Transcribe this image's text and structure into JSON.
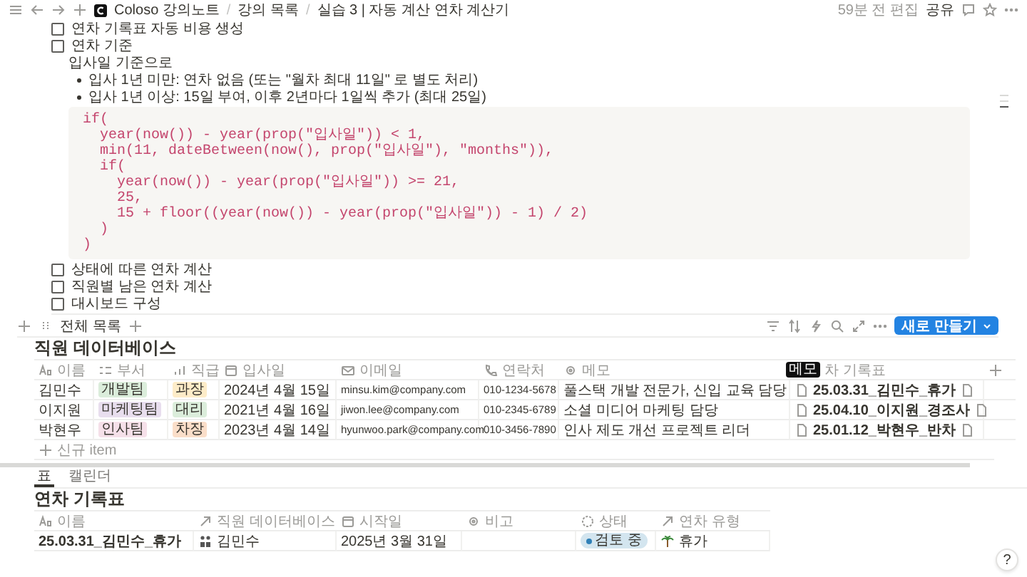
{
  "topbar": {
    "breadcrumbs": [
      "Coloso 강의노트",
      "강의 목록",
      "실습 3 | 자동 계산 연차 계산기"
    ],
    "separator": "/",
    "edited": "59분 전 편집",
    "share": "공유"
  },
  "blocks": [
    {
      "kind": "todo",
      "text": "연차 기록표 자동 비용 생성",
      "checked": false
    },
    {
      "kind": "todo",
      "text": "연차 기준",
      "checked": false
    },
    {
      "kind": "text",
      "text": "입사일 기준으로"
    },
    {
      "kind": "bullet",
      "text": "입사 1년 미만: 연차 없음 (또는 \"월차 최대 11일\" 로 별도 처리)"
    },
    {
      "kind": "bullet",
      "text": "입사 1년 이상: 15일 부여, 이후 2년마다 1일씩 추가 (최대 25일)"
    },
    {
      "kind": "code",
      "lines": [
        "if(",
        "  year(now()) - year(prop(\"입사일\")) < 1,",
        "  min(11, dateBetween(now(), prop(\"입사일\"), \"months\")),",
        "  if(",
        "    year(now()) - year(prop(\"입사일\")) >= 21,",
        "    25,",
        "    15 + floor((year(now()) - year(prop(\"입사일\")) - 1) / 2)",
        "  )",
        ")"
      ]
    },
    {
      "kind": "todo",
      "text": "상태에 따른 연차 계산",
      "checked": false
    },
    {
      "kind": "todo",
      "text": "직원별 남은 연차 계산",
      "checked": false
    },
    {
      "kind": "todo",
      "text": "대시보드 구성",
      "checked": false
    }
  ],
  "employee_db": {
    "view": "전체 목록",
    "new_button": "새로 만들기",
    "title": "직원 데이터베이스",
    "tooltip": "메모",
    "columns": [
      {
        "label": "이름",
        "kind": "title"
      },
      {
        "label": "부서",
        "kind": "multi"
      },
      {
        "label": "직급",
        "kind": "select"
      },
      {
        "label": "입사일",
        "kind": "date"
      },
      {
        "label": "이메일",
        "kind": "email"
      },
      {
        "label": "연락처",
        "kind": "phone"
      },
      {
        "label": "메모",
        "kind": "text"
      },
      {
        "label": "차 기록표"
      }
    ],
    "rows": [
      {
        "name": "김민수",
        "dept": {
          "text": "개발팀",
          "color": "#dbeddb"
        },
        "rank": {
          "text": "과장",
          "color": "#fdecc8"
        },
        "date": "2024년 4월 15일",
        "email": "minsu.kim@company.com",
        "phone": "010-1234-5678",
        "memo": "풀스택 개발 전문가, 신입 교육 담당",
        "record": "25.03.31_김민수_휴가"
      },
      {
        "name": "이지원",
        "dept": {
          "text": "마케팅팀",
          "color": "#e8deee"
        },
        "rank": {
          "text": "대리",
          "color": "#dbeddb"
        },
        "date": "2021년 4월 16일",
        "email": "jiwon.lee@company.com",
        "phone": "010-2345-6789",
        "memo": "소셜 미디어 마케팅 담당",
        "record": "25.04.10_이지원_경조사"
      },
      {
        "name": "박현우",
        "dept": {
          "text": "인사팀",
          "color": "#f5e0e9"
        },
        "rank": {
          "text": "차장",
          "color": "#fadec9"
        },
        "date": "2023년 4월 14일",
        "email": "hyunwoo.park@company.com",
        "phone": "010-3456-7890",
        "memo": "인사 제도 개선 프로젝트 리더",
        "record": "25.01.12_박현우_반차"
      }
    ],
    "new_item": "신규 item"
  },
  "leave_db": {
    "tabs": [
      {
        "label": "표",
        "selected": true
      },
      {
        "label": "캘린더",
        "selected": false
      }
    ],
    "title": "연차 기록표",
    "columns": [
      {
        "label": "이름",
        "kind": "title"
      },
      {
        "label": "직원 데이터베이스",
        "kind": "relation"
      },
      {
        "label": "시작일",
        "kind": "date"
      },
      {
        "label": "비고",
        "kind": "text"
      },
      {
        "label": "상태",
        "kind": "status"
      },
      {
        "label": "연차 유형",
        "kind": "relation"
      }
    ],
    "rows": [
      {
        "name": "25.03.31_김민수_휴가",
        "employee": "김민수",
        "start": "2025년 3월 31일",
        "status": {
          "text": "검토 중",
          "color": "#2f80b7"
        },
        "type": "휴가"
      }
    ]
  },
  "help_button": "?"
}
